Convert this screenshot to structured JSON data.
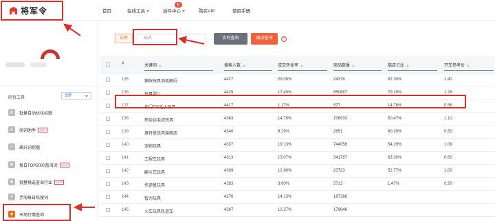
{
  "brand": {
    "name": "将军令"
  },
  "nav": {
    "home": "首页",
    "tools": "在线工具",
    "plugin_center": "插件中心",
    "plugin_badge": "新",
    "buy_vip": "购买VIP",
    "manual": "使用手册"
  },
  "sidebar": {
    "section_label": "网页工具",
    "filter_selected": "全部",
    "items": [
      {
        "label": "批量自动优化标题",
        "icon": "batch-title-icon",
        "hot": ""
      },
      {
        "label": "淘词助手",
        "icon": "word-helper-icon",
        "hot": "HOT"
      },
      {
        "label": "飙升词挖掘",
        "icon": "rising-words-icon",
        "hot": ""
      },
      {
        "label": "每日TOP5000蓝海词",
        "icon": "top5000-icon",
        "hot": "HOT"
      },
      {
        "label": "批量挑选蓝海行业",
        "icon": "blue-ocean-icon",
        "hot": "HOT"
      },
      {
        "label": "手淘每日热搜词",
        "icon": "hot-search-icon",
        "hot": ""
      },
      {
        "label": "市场行情查询",
        "icon": "market-query-icon",
        "hot": ""
      }
    ]
  },
  "search": {
    "tab_realtime": "实时",
    "input_value": "玩具",
    "btn_realtime_query": "实时查询",
    "btn_random_query": "随派查词",
    "help": "?"
  },
  "table": {
    "columns": [
      "#",
      "关键词",
      "搜索人数",
      "成交转化率",
      "商品数量",
      "猫店占比",
      "开车参考价"
    ],
    "rows": [
      {
        "idx": "135",
        "keyword": "猫咪玩具消耗解闷",
        "searchers": "4427",
        "conv": "28.09%",
        "items": "24376",
        "tmall": "82.30%",
        "price": "1.40"
      },
      {
        "idx": "136",
        "keyword": "玩具婴儿",
        "searchers": "4429",
        "conv": "17.49%",
        "items": "850887",
        "tmall": "79.29%",
        "price": "1.28"
      },
      {
        "idx": "137",
        "keyword": "校门口5毛小玩具",
        "searchers": "4417",
        "conv": "1.17%",
        "items": "577",
        "tmall": "14.78%",
        "price": "0.56"
      },
      {
        "idx": "138",
        "keyword": "布娃娃毛绒玩具",
        "searchers": "4363",
        "conv": "14.78%",
        "items": "706933",
        "tmall": "50.47%",
        "price": "1.10"
      },
      {
        "idx": "139",
        "keyword": "奥特曼玩具旗舰店",
        "searchers": "4340",
        "conv": "9.29%",
        "items": "2651",
        "tmall": "80.29%",
        "price": "0.50"
      },
      {
        "idx": "140",
        "keyword": "宠物玩具",
        "searchers": "4337",
        "conv": "19.13%",
        "items": "744056",
        "tmall": "54.29%",
        "price": "1.09"
      },
      {
        "idx": "141",
        "keyword": "工程车玩具",
        "searchers": "4313",
        "conv": "13.07%",
        "items": "341787",
        "tmall": "63.30%",
        "price": "0.60"
      },
      {
        "idx": "142",
        "keyword": "翻斗车玩具",
        "searchers": "4309",
        "conv": "12.90%",
        "items": "23723",
        "tmall": "52.77%",
        "price": "1.00"
      },
      {
        "idx": "143",
        "keyword": "传递基玩具",
        "searchers": "4283",
        "conv": "3.60%",
        "items": "5713",
        "tmall": "1.47%",
        "price": "0.20"
      },
      {
        "idx": "144",
        "keyword": "智力玩具",
        "searchers": "4276",
        "conv": "14.13%",
        "items": "187386",
        "tmall": "",
        "price": ""
      },
      {
        "idx": "145",
        "keyword": "火车玩具轨道车",
        "searchers": "4267",
        "conv": "12.27%",
        "items": "179846",
        "tmall": "",
        "price": ""
      }
    ]
  },
  "colors": {
    "accent": "#f26b1d",
    "highlight": "#d9312a",
    "brand_red": "#cc3333"
  }
}
